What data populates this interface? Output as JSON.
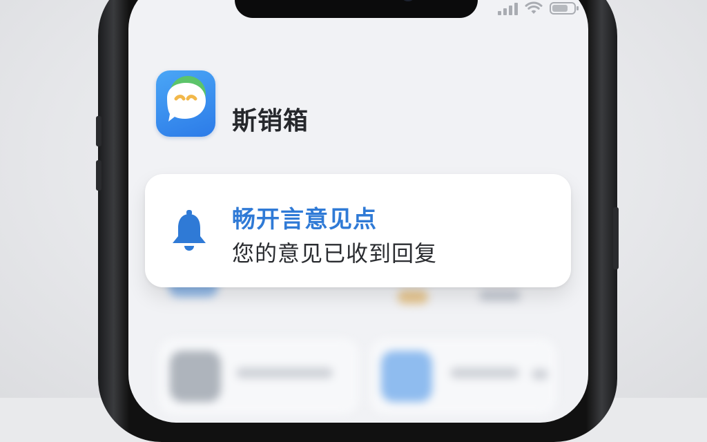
{
  "app": {
    "name": "斯销箱",
    "icon": "chat-bubble-app-icon"
  },
  "notification": {
    "title": "畅开言意见点",
    "body": "您的意见已收到回复",
    "icon": "bell-icon"
  },
  "status_bar": {
    "icons": [
      "signal-icon",
      "wifi-icon",
      "battery-icon"
    ]
  },
  "colors": {
    "accent": "#2f7ad6",
    "app_icon_blue": "#2c7be8",
    "bubble_green": "#5cc46a",
    "background": "#f1f2f5"
  }
}
